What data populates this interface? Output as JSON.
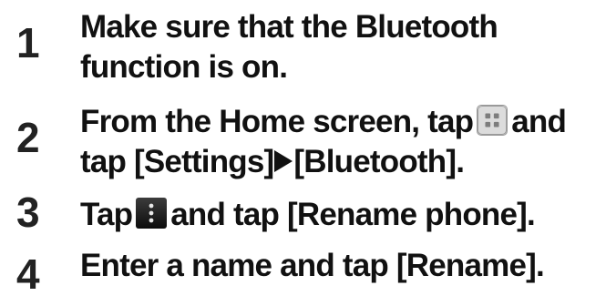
{
  "steps": [
    {
      "number": "1",
      "line1": "Make sure that the Bluetooth",
      "line2": "function is on."
    },
    {
      "number": "2",
      "line1_before_icon": "From the Home screen, tap",
      "line1_icon": "apps-icon",
      "line1_after_icon": "and",
      "line2_a": "tap [Settings]",
      "line2_separator_icon": "right-triangle-icon",
      "line2_b": "[Bluetooth]."
    },
    {
      "number": "3",
      "before_icon": "Tap",
      "icon": "menu-icon",
      "after_icon": "and tap [Rename phone]."
    },
    {
      "number": "4",
      "text": "Enter a name and tap [Rename]."
    }
  ],
  "colors": {
    "text": "#111111",
    "background": "#ffffff"
  }
}
